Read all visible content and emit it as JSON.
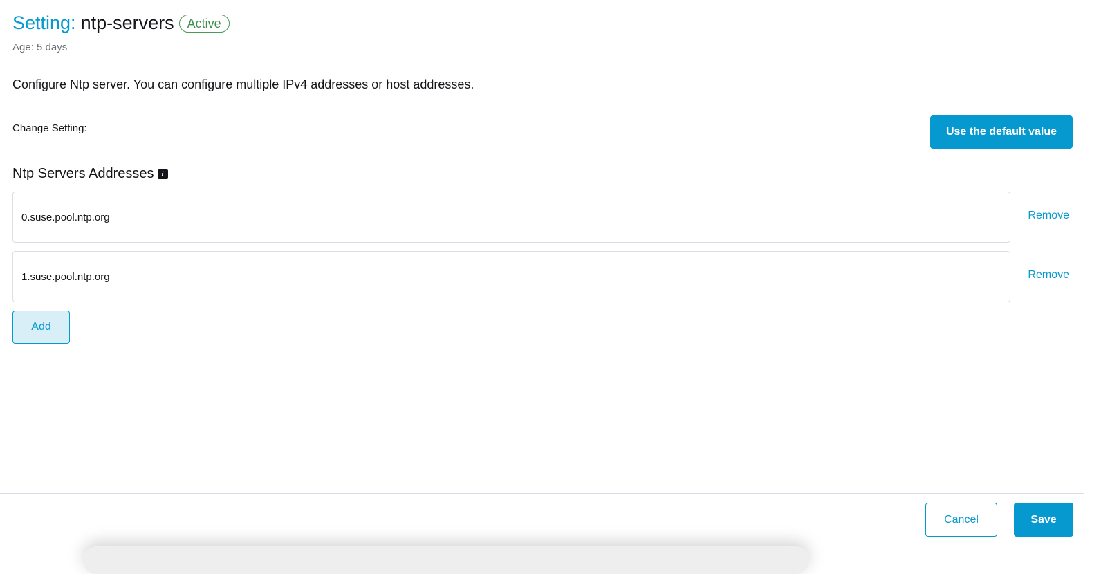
{
  "header": {
    "title_prefix": "Setting:",
    "title_name": "ntp-servers",
    "status": "Active",
    "age": "Age: 5 days"
  },
  "description": "Configure Ntp server. You can configure multiple IPv4 addresses or host addresses.",
  "change_setting": {
    "label": "Change Setting:",
    "default_button": "Use the default value"
  },
  "servers": {
    "label": "Ntp Servers Addresses",
    "items": [
      {
        "value": "0.suse.pool.ntp.org",
        "remove": "Remove"
      },
      {
        "value": "1.suse.pool.ntp.org",
        "remove": "Remove"
      }
    ],
    "add": "Add"
  },
  "footer": {
    "cancel": "Cancel",
    "save": "Save"
  },
  "colors": {
    "accent": "#0599d0",
    "active": "#3d8f4c"
  }
}
